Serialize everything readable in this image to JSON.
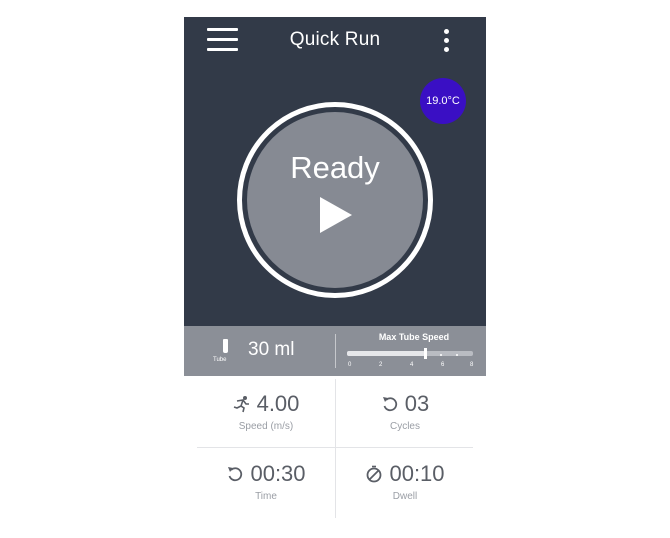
{
  "appbar": {
    "title": "Quick Run",
    "menu_icon": "hamburger-menu-icon",
    "more_icon": "more-vertical-icon"
  },
  "temperature": {
    "value": "19.0°C",
    "color": "#3a0fc4"
  },
  "start": {
    "status": "Ready",
    "icon": "play-icon"
  },
  "tube": {
    "icon": "tube-icon",
    "caption": "Tube",
    "volume": "30 ml"
  },
  "max_speed": {
    "title": "Max Tube Speed",
    "ticks": [
      "0",
      "2",
      "4",
      "6",
      "8"
    ],
    "level": 0.62
  },
  "params": {
    "speed": {
      "value": "4.00",
      "label": "Speed (m/s)",
      "icon": "runner-icon"
    },
    "cycles": {
      "value": "03",
      "label": "Cycles",
      "icon": "repeat-icon"
    },
    "time": {
      "value": "00:30",
      "label": "Time",
      "icon": "repeat-icon"
    },
    "dwell": {
      "value": "00:10",
      "label": "Dwell",
      "icon": "stopwatch-icon"
    }
  },
  "colors": {
    "panel": "#323a48",
    "disc": "#868a93",
    "info_bar": "#8b8f97"
  }
}
